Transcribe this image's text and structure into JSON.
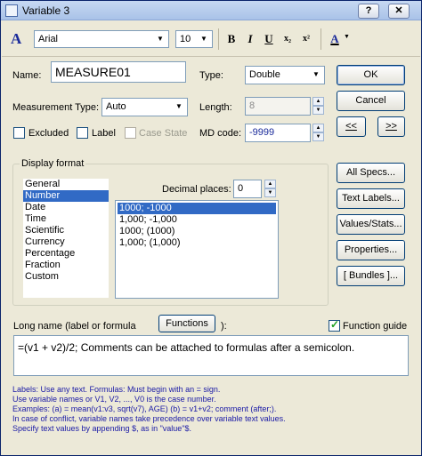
{
  "window": {
    "title": "Variable 3"
  },
  "titlebar_buttons": {
    "help": "?",
    "close": "✕"
  },
  "toolbar": {
    "font_name": "Arial",
    "font_size": "10",
    "bold": "B",
    "italic": "I",
    "underline": "U",
    "subscript": "x₂",
    "superscript": "x²",
    "font_color": "A"
  },
  "fields": {
    "name_label": "Name:",
    "name_value": "MEASURE01",
    "type_label": "Type:",
    "type_value": "Double",
    "measurement_type_label": "Measurement Type:",
    "measurement_type_value": "Auto",
    "length_label": "Length:",
    "length_value": "8",
    "md_code_label": "MD code:",
    "md_code_value": "-9999"
  },
  "checkboxes": {
    "excluded": "Excluded",
    "label": "Label",
    "case_state": "Case State"
  },
  "buttons": {
    "ok": "OK",
    "cancel": "Cancel",
    "prev": "<<",
    "next": ">>",
    "all_specs": "All Specs...",
    "text_labels": "Text Labels...",
    "values_stats": "Values/Stats...",
    "properties": "Properties...",
    "bundles": "[ Bundles ]...",
    "functions": "Functions"
  },
  "display_format": {
    "title": "Display format",
    "formats": [
      "General",
      "Number",
      "Date",
      "Time",
      "Scientific",
      "Currency",
      "Percentage",
      "Fraction",
      "Custom"
    ],
    "selected_format": "Number",
    "decimal_places_label": "Decimal places:",
    "decimal_places_value": "0",
    "number_styles": [
      "1000; -1000",
      "1,000; -1,000",
      "1000; (1000)",
      "1,000; (1,000)"
    ],
    "selected_style": "1000; -1000"
  },
  "long_name": {
    "label_prefix": "Long name (label or formula",
    "label_suffix": "):",
    "function_guide_label": "Function guide",
    "function_guide_checked": true,
    "formula": "=(v1 + v2)/2; Comments can be attached to formulas after a semicolon."
  },
  "help_text": [
    "Labels: Use any text.  Formulas: Must begin with an = sign.",
    "Use variable names or V1, V2, ..., V0 is the case number.",
    "Examples: (a) = mean(v1:v3, sqrt(v7), AGE) (b) = v1+v2; comment (after;).",
    "In case of conflict, variable names take precedence over variable text values.",
    "Specify text values by appending $, as in \"value\"$."
  ],
  "colors": {
    "selection": "#316ac5",
    "help_text": "#1a1aa6",
    "dialog_bg": "#ece9d8"
  }
}
